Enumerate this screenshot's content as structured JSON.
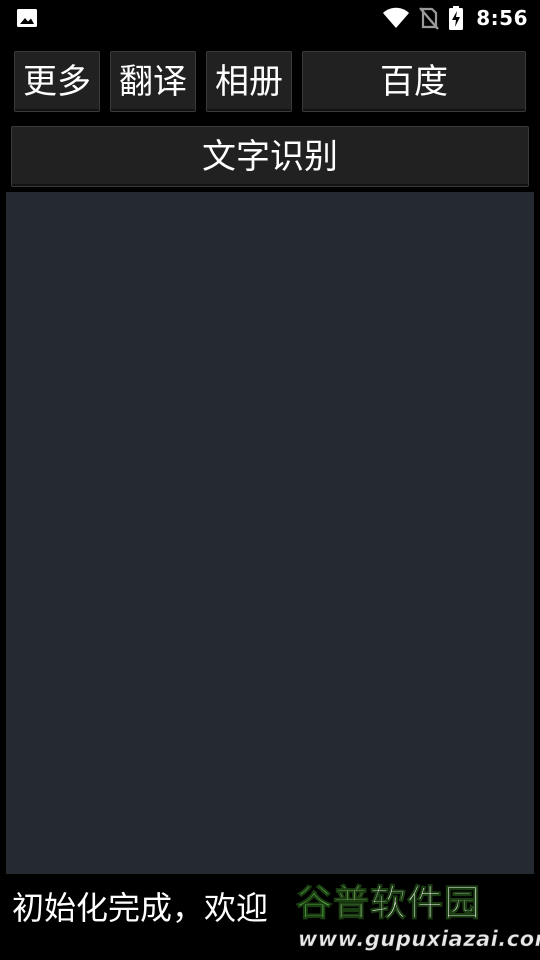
{
  "status_bar": {
    "time": "8:56",
    "left_icon": "image-icon",
    "icons": [
      "wifi-icon",
      "no-sim-icon",
      "battery-charging-icon"
    ]
  },
  "toolbar": {
    "more_label": "更多",
    "translate_label": "翻译",
    "album_label": "相册",
    "baidu_label": "百度"
  },
  "ocr_button_label": "文字识别",
  "text_area": {
    "value": ""
  },
  "status_message": "初始化完成，欢迎",
  "watermark": {
    "brand_part1": "谷",
    "brand_part2": "普",
    "brand_part3": "软件园",
    "url": "www.gupuxiazai.com"
  },
  "colors": {
    "background": "#000000",
    "button_bg": "#212121",
    "text_area_bg": "#252a31",
    "text": "#ffffff",
    "watermark_green": "#5db84a"
  }
}
